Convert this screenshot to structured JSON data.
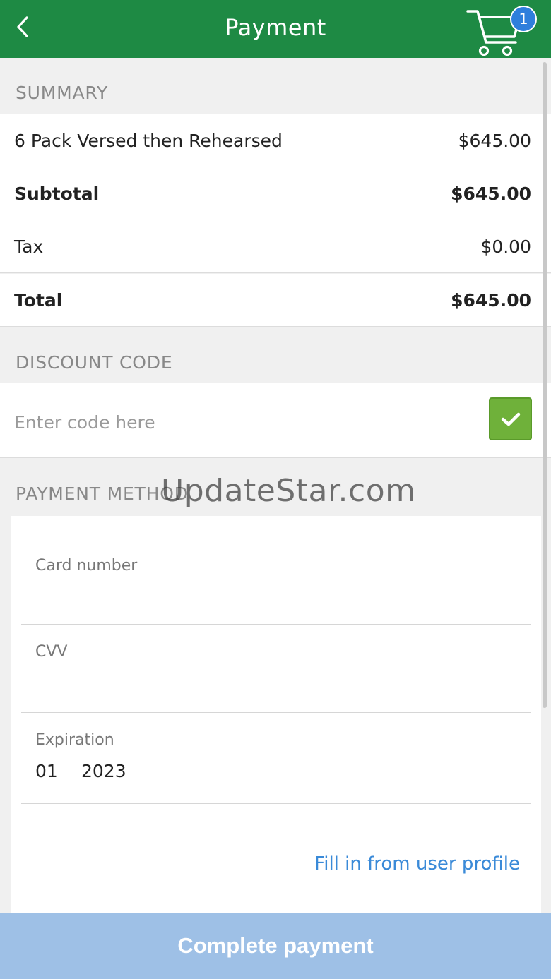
{
  "header": {
    "title": "Payment",
    "back_icon": "chevron-left-icon",
    "cart_icon": "cart-icon",
    "cart_count": "1",
    "color": "#1e8a44",
    "badge_color": "#2f7fdc"
  },
  "summary": {
    "label": "SUMMARY",
    "item": {
      "name": "6 Pack Versed then Rehearsed",
      "price": "$645.00"
    },
    "subtotal": {
      "label": "Subtotal",
      "value": "$645.00"
    },
    "tax": {
      "label": "Tax",
      "value": "$0.00"
    },
    "total": {
      "label": "Total",
      "value": "$645.00"
    }
  },
  "discount": {
    "label": "DISCOUNT CODE",
    "placeholder": "Enter code here",
    "value": "",
    "apply_icon": "checkmark-icon",
    "apply_color": "#6fb13a"
  },
  "payment_method": {
    "label": "PAYMENT METHOD",
    "card_number_label": "Card number",
    "card_number_value": "",
    "cvv_label": "CVV",
    "cvv_value": "",
    "expiration_label": "Expiration",
    "expiration_month": "01",
    "expiration_year": "2023",
    "fill_link": "Fill in from user profile",
    "link_color": "#3a8ad8"
  },
  "watermark": "UpdateStar.com",
  "complete_button": {
    "label": "Complete payment",
    "color": "#9ec0e6"
  }
}
